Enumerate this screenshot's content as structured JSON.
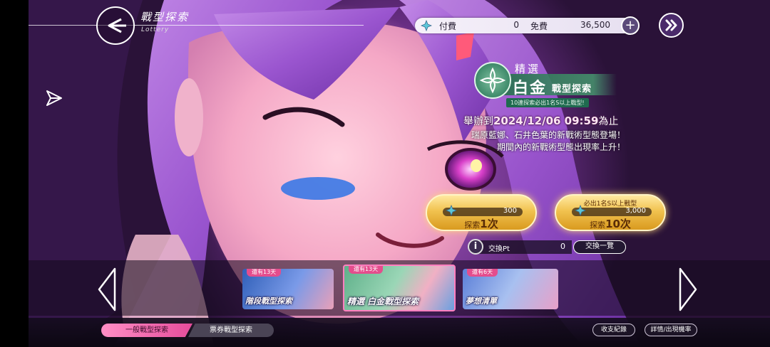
{
  "header": {
    "title": "戰型探索",
    "subtitle": "Lottery"
  },
  "currency": {
    "paid_label": "付費",
    "paid_value": "0",
    "free_label": "免費",
    "free_value": "36,500",
    "plus_icon": "plus-icon"
  },
  "banner": {
    "pick_label": "精選",
    "main_title": "白金",
    "main_suffix": "戰型探索",
    "note": "10連探索必出1名S以上戰型!",
    "period_prefix": "舉辦到",
    "period_date": "2024/12/06 09:59",
    "period_suffix": "為止",
    "desc_line1": "瑞原藍娜、石井色葉的新戰術型態登場！",
    "desc_line2": "期間內的新戰術型態出現率上升！"
  },
  "pulls": [
    {
      "cost": "300",
      "label_prefix": "探索",
      "label_count": "1次",
      "top_note": ""
    },
    {
      "cost": "3,000",
      "label_prefix": "探索",
      "label_count": "10次",
      "top_note": "必出1名S以上戰型"
    }
  ],
  "exchange": {
    "icon": "info-icon",
    "label": "交換Pt",
    "value": "0",
    "list_button": "交換一覽"
  },
  "carousel": {
    "cards": [
      {
        "tag": "還有13天",
        "title": "階段戰型探索",
        "selected": false
      },
      {
        "tag": "還有13天",
        "title": "精選 白金戰型探索",
        "selected": true
      },
      {
        "tag": "還有6天",
        "title": "夢想清單",
        "selected": false
      }
    ]
  },
  "tabs": [
    {
      "label": "一般戰型探索",
      "active": true
    },
    {
      "label": "票券戰型探索",
      "active": false
    }
  ],
  "footer_buttons": {
    "history": "收支紀錄",
    "details": "詳情/出現機率"
  },
  "colors": {
    "accent_pink": "#e54c9b",
    "gold": "#f1c24f",
    "banner_green": "#3e8a6a"
  }
}
